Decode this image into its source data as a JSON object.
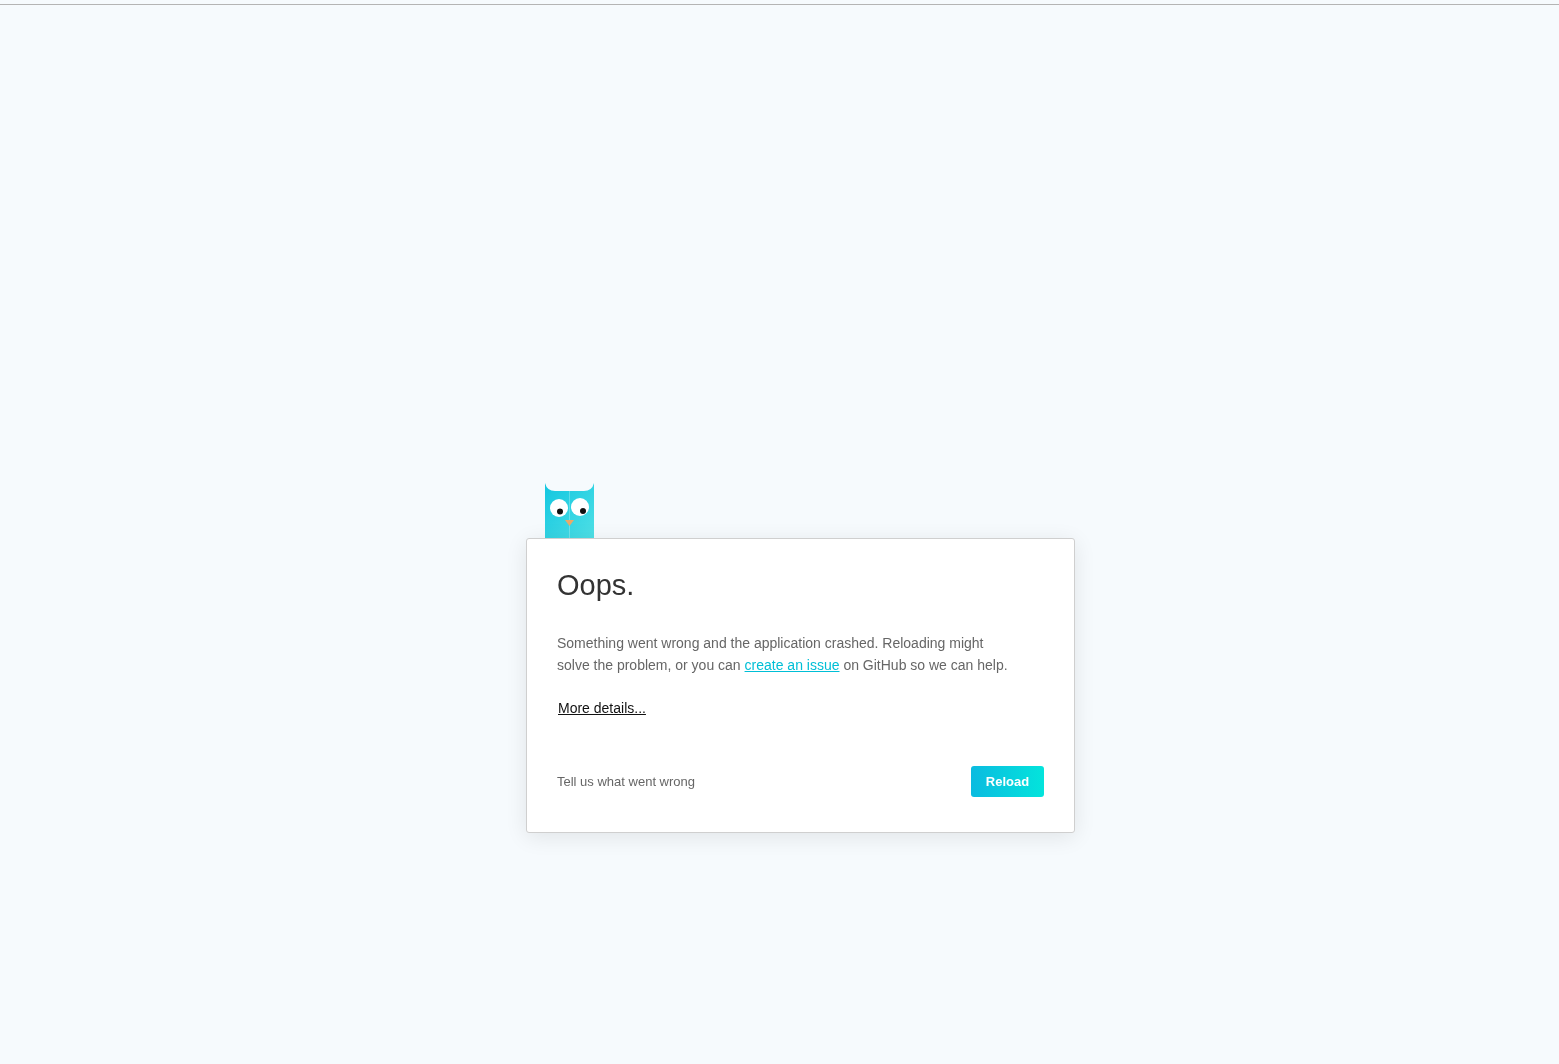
{
  "error_card": {
    "title": "Oops.",
    "message": [
      {
        "kind": "text",
        "text": "Something went wrong and the application crashed. Reloading might solve the problem, or you can"
      },
      {
        "kind": "link",
        "text": "create an issue"
      },
      {
        "kind": "text",
        "text": "on GitHub so we can help."
      }
    ],
    "details_link": "More details...",
    "feedback_prompt": "Tell us what went wrong",
    "reload_button": "Reload"
  }
}
